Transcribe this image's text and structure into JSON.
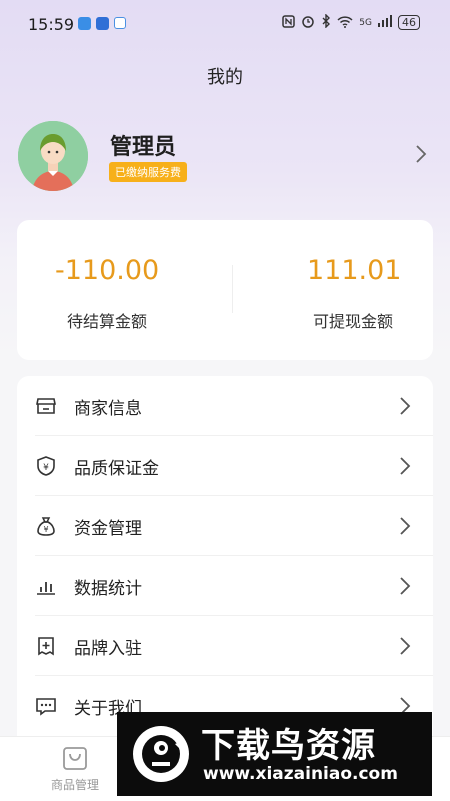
{
  "status_bar": {
    "time": "15:59",
    "network": "5G",
    "battery": "46"
  },
  "header": {
    "title": "我的"
  },
  "profile": {
    "name": "管理员",
    "badge": "已缴纳服务费"
  },
  "balance": {
    "pending_amount": "-110.00",
    "pending_label": "待结算金额",
    "withdrawable_amount": "111.01",
    "withdrawable_label": "可提现金额"
  },
  "menu": {
    "items": [
      {
        "label": "商家信息",
        "icon": "store-icon"
      },
      {
        "label": "品质保证金",
        "icon": "yen-shield-icon"
      },
      {
        "label": "资金管理",
        "icon": "money-bag-icon"
      },
      {
        "label": "数据统计",
        "icon": "bar-chart-icon"
      },
      {
        "label": "品牌入驻",
        "icon": "add-brand-icon"
      },
      {
        "label": "关于我们",
        "icon": "chat-dots-icon"
      }
    ]
  },
  "tabbar": {
    "items": [
      {
        "label": "商品管理",
        "icon": "shopping-bag-icon"
      }
    ]
  },
  "watermark": {
    "title": "下载鸟资源",
    "url": "www.xiazainiao.com"
  },
  "colors": {
    "accent": "#e79a1c",
    "badge": "#f7b01a",
    "avatar_bg": "#8fcfa1"
  }
}
